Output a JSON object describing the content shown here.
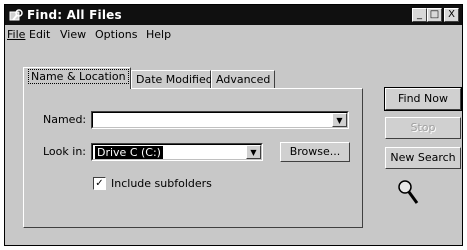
{
  "window": {
    "title": "Find: All Files",
    "minimize": "_",
    "maximize": "□",
    "close": "X"
  },
  "menu": [
    "File",
    "Edit",
    "View",
    "Options",
    "Help"
  ],
  "tabs": [
    "Name & Location",
    "Date Modified",
    "Advanced"
  ],
  "form": {
    "named_label": "Named:",
    "named_value": "",
    "lookin_label": "Look in:",
    "lookin_value": "Drive C (C:)",
    "browse_label": "Browse...",
    "subfolders_label": "Include subfolders",
    "subfolders_checked": true
  },
  "buttons": {
    "find_now": "Find Now",
    "stop": "Stop",
    "new_search": "New Search"
  },
  "icons": {
    "title": "find-folder-icon",
    "search": "magnifier-icon"
  }
}
